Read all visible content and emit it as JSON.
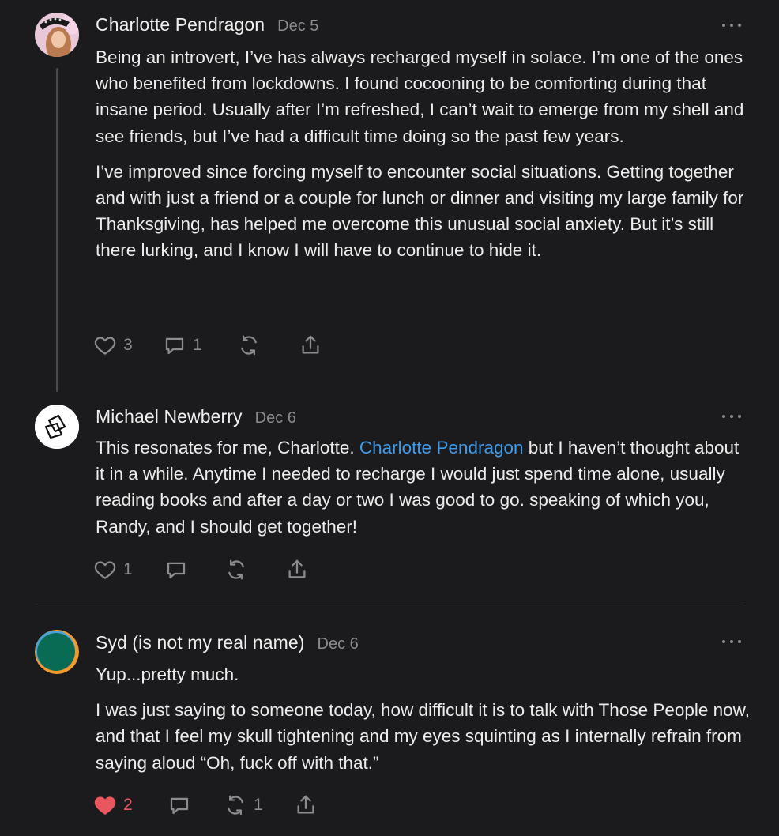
{
  "comments": [
    {
      "author": "Charlotte Pendragon",
      "date": "Dec 5",
      "paragraphs": [
        "Being an introvert, I’ve has always recharged myself in solace. I’m one of the ones who benefited from lockdowns. I found cocooning to be comforting during that insane period. Usually after I’m refreshed, I can’t wait to emerge from my shell and see friends, but I’ve had a difficult time doing so the past few years.",
        "I’ve improved since forcing myself to encounter social situations. Getting together and with just a friend or a couple for lunch or dinner and visiting my large family for Thanksgiving, has helped me overcome this unusual social anxiety. But it’s still there lurking, and I know I will have to continue to hide it."
      ],
      "likes": "3",
      "replies": "1",
      "restacks": "",
      "liked": false
    },
    {
      "author": "Michael Newberry",
      "date": "Dec 6",
      "text_before": "This resonates for me, Charlotte. ",
      "mention": "Charlotte Pendragon",
      "text_after": " but I haven’t thought about it in a while. Anytime I needed to recharge I would just spend time alone, usually reading books and after a day or two I was good to go. speaking of which you, Randy, and I should get together!",
      "likes": "1",
      "replies": "",
      "restacks": "",
      "liked": false
    },
    {
      "author": "Syd (is not my real name)",
      "date": "Dec 6",
      "paragraphs": [
        "Yup...pretty much.",
        "I was just saying to someone today, how difficult it is to talk with Those People now, and that I feel my skull tightening and my eyes squinting as I internally refrain from saying aloud “Oh, fuck off with that.”"
      ],
      "likes": "2",
      "replies": "",
      "restacks": "1",
      "liked": true
    }
  ],
  "icons": {
    "like": "heart-icon",
    "reply": "comment-bubble-icon",
    "restack": "restack-icon",
    "share": "share-icon",
    "more": "more-icon"
  },
  "colors": {
    "background": "#1b1b1d",
    "text": "#ececec",
    "muted": "#8c8c90",
    "mention": "#3f9ae8",
    "liked": "#e8575e",
    "thread_line": "#4a4a4d"
  }
}
